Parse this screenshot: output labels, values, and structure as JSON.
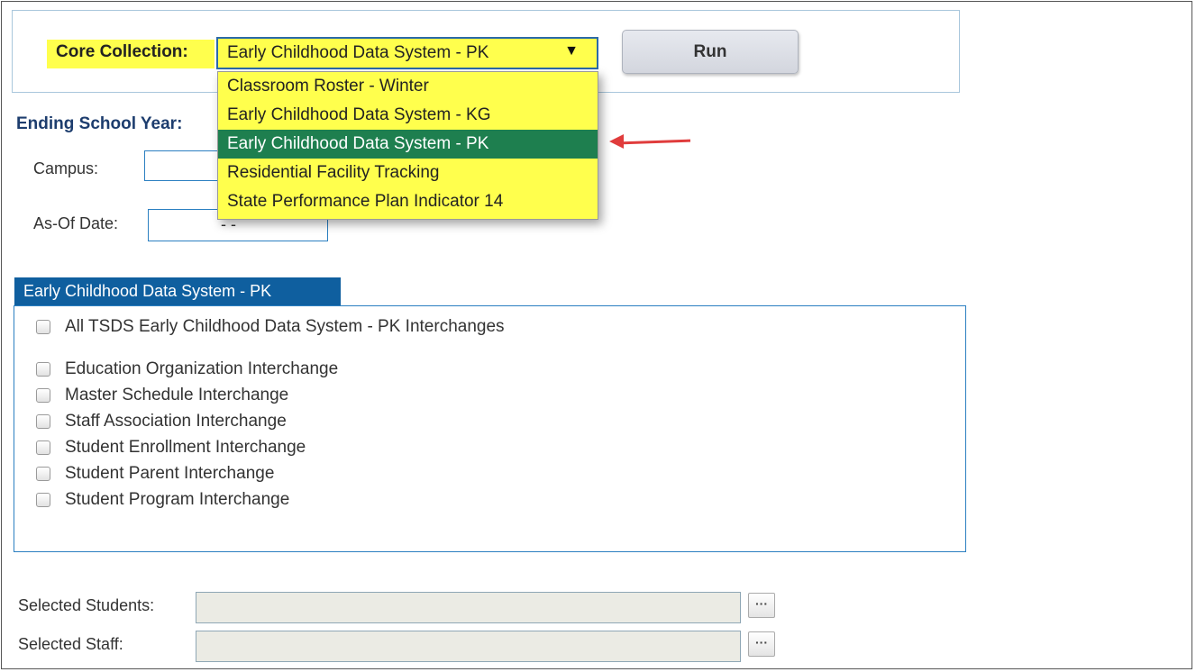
{
  "core_collection": {
    "label": "Core Collection:",
    "selected_value": "Early Childhood Data System - PK",
    "dropdown_arrow": "▼",
    "options": [
      "Classroom Roster - Winter",
      "Early Childhood Data System - KG",
      "Early Childhood Data System - PK",
      "Residential Facility Tracking",
      "State Performance Plan Indicator 14"
    ],
    "highlight_color": "#ffff4d",
    "selected_option_color": "#1e7f4f"
  },
  "run_button": {
    "label": "Run"
  },
  "annotation": {
    "arrow_color": "#e03c3c",
    "arrow_icon": "red-arrow-icon"
  },
  "ending_school_year": {
    "label": "Ending School Year: "
  },
  "campus": {
    "label": "Campus:",
    "value": ""
  },
  "as_of_date": {
    "label": "As-Of Date:",
    "value": "- -"
  },
  "interchanges": {
    "tab_title": "Early Childhood Data System - PK",
    "all_label": "All TSDS Early Childhood Data System - PK Interchanges",
    "items": [
      "Education Organization Interchange",
      "Master Schedule Interchange",
      "Staff Association Interchange",
      "Student Enrollment Interchange",
      "Student Parent Interchange",
      "Student Program Interchange"
    ],
    "tab_color": "#0f5f9f"
  },
  "selected_students": {
    "label": "Selected Students:",
    "value": "",
    "button_label": "···"
  },
  "selected_staff": {
    "label": "Selected Staff:",
    "value": "",
    "button_label": "···"
  }
}
